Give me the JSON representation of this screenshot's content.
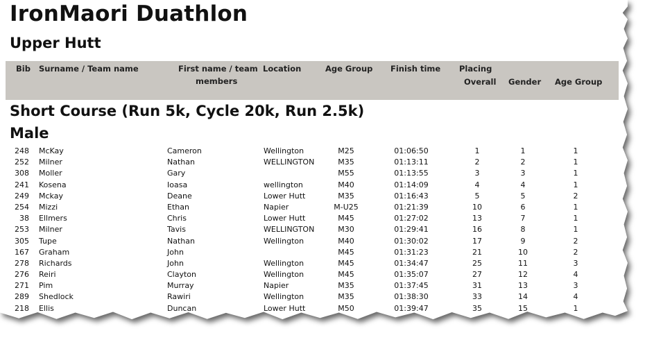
{
  "document": {
    "title": "IronMaori Duathlon",
    "subtitle": "Upper Hutt",
    "header": {
      "bib": "Bib",
      "surname": "Surname / Team name",
      "firstname_line1": "First name / team",
      "firstname_line2": "members",
      "location": "Location",
      "age_group": "Age Group",
      "finish_time": "Finish time",
      "placing": "Placing",
      "overall": "Overall",
      "gender": "Gender",
      "placing_age_group": "Age Group"
    },
    "section_title": "Short Course (Run 5k, Cycle 20k, Run 2.5k)",
    "group_title": "Male",
    "rows": [
      {
        "bib": "248",
        "surname": "McKay",
        "first": "Cameron",
        "location": "Wellington",
        "age": "M25",
        "time": "01:06:50",
        "overall": "1",
        "gender": "1",
        "age_place": "1"
      },
      {
        "bib": "252",
        "surname": "Milner",
        "first": "Nathan",
        "location": "WELLINGTON",
        "age": "M35",
        "time": "01:13:11",
        "overall": "2",
        "gender": "2",
        "age_place": "1"
      },
      {
        "bib": "308",
        "surname": "Moller",
        "first": "Gary",
        "location": "",
        "age": "M55",
        "time": "01:13:55",
        "overall": "3",
        "gender": "3",
        "age_place": "1"
      },
      {
        "bib": "241",
        "surname": "Kosena",
        "first": "Ioasa",
        "location": "wellington",
        "age": "M40",
        "time": "01:14:09",
        "overall": "4",
        "gender": "4",
        "age_place": "1"
      },
      {
        "bib": "249",
        "surname": "Mckay",
        "first": "Deane",
        "location": "Lower Hutt",
        "age": "M35",
        "time": "01:16:43",
        "overall": "5",
        "gender": "5",
        "age_place": "2"
      },
      {
        "bib": "254",
        "surname": "Mizzi",
        "first": "Ethan",
        "location": "Napier",
        "age": "M-U25",
        "time": "01:21:39",
        "overall": "10",
        "gender": "6",
        "age_place": "1"
      },
      {
        "bib": "38",
        "surname": "Ellmers",
        "first": "Chris",
        "location": "Lower Hutt",
        "age": "M45",
        "time": "01:27:02",
        "overall": "13",
        "gender": "7",
        "age_place": "1"
      },
      {
        "bib": "253",
        "surname": "Milner",
        "first": "Tavis",
        "location": "WELLINGTON",
        "age": "M30",
        "time": "01:29:41",
        "overall": "16",
        "gender": "8",
        "age_place": "1"
      },
      {
        "bib": "305",
        "surname": "Tupe",
        "first": "Nathan",
        "location": "Wellington",
        "age": "M40",
        "time": "01:30:02",
        "overall": "17",
        "gender": "9",
        "age_place": "2"
      },
      {
        "bib": "167",
        "surname": "Graham",
        "first": "John",
        "location": "",
        "age": "M45",
        "time": "01:31:23",
        "overall": "21",
        "gender": "10",
        "age_place": "2"
      },
      {
        "bib": "278",
        "surname": "Richards",
        "first": "John",
        "location": "Wellington",
        "age": "M45",
        "time": "01:34:47",
        "overall": "25",
        "gender": "11",
        "age_place": "3"
      },
      {
        "bib": "276",
        "surname": "Reiri",
        "first": "Clayton",
        "location": "Wellington",
        "age": "M45",
        "time": "01:35:07",
        "overall": "27",
        "gender": "12",
        "age_place": "4"
      },
      {
        "bib": "271",
        "surname": "Pim",
        "first": "Murray",
        "location": "Napier",
        "age": "M35",
        "time": "01:37:45",
        "overall": "31",
        "gender": "13",
        "age_place": "3"
      },
      {
        "bib": "289",
        "surname": "Shedlock",
        "first": "Rawiri",
        "location": "Wellington",
        "age": "M35",
        "time": "01:38:30",
        "overall": "33",
        "gender": "14",
        "age_place": "4"
      },
      {
        "bib": "218",
        "surname": "Ellis",
        "first": "Duncan",
        "location": "Lower Hutt",
        "age": "M50",
        "time": "01:39:47",
        "overall": "35",
        "gender": "15",
        "age_place": "1"
      }
    ]
  }
}
